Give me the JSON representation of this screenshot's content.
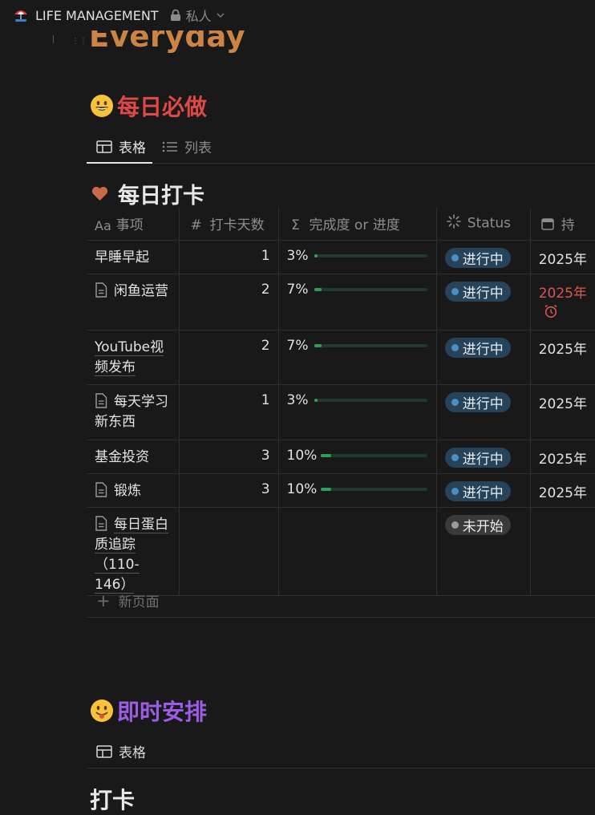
{
  "topbar": {
    "app_title": "LIFE MANAGEMENT",
    "privacy": "私人",
    "app_icon": "beach-umbrella-icon"
  },
  "page": {
    "title": "Everyday"
  },
  "section1": {
    "title": "每日必做",
    "title_color": "#e04848",
    "emoji": "grinning-face",
    "tabs": [
      {
        "label": "表格",
        "icon": "table-icon",
        "active": true
      },
      {
        "label": "列表",
        "icon": "list-icon",
        "active": false
      }
    ],
    "db_title": "每日打卡",
    "columns": [
      {
        "icon": "Aa",
        "label": "事项"
      },
      {
        "icon": "#",
        "label": "打卡天数"
      },
      {
        "icon": "Σ",
        "label": "完成度 or 进度"
      },
      {
        "icon": "status-icon",
        "label": "Status"
      },
      {
        "icon": "calendar-icon",
        "label": "持"
      }
    ],
    "rows": [
      {
        "name": "早睡早起",
        "page": false,
        "days": "1",
        "pct": "3%",
        "progress": 0.03,
        "status": "进行中",
        "date": "2025年"
      },
      {
        "name": "闲鱼运营",
        "page": true,
        "days": "2",
        "pct": "7%",
        "progress": 0.07,
        "status": "进行中",
        "date": "2025年"
      },
      {
        "name": "YouTube视频发布",
        "page": false,
        "days": "2",
        "pct": "7%",
        "progress": 0.07,
        "status": "进行中",
        "date": "2025年"
      },
      {
        "name": "每天学习新东西",
        "page": true,
        "days": "1",
        "pct": "3%",
        "progress": 0.03,
        "status": "进行中",
        "date": "2025年"
      },
      {
        "name": "基金投资",
        "page": false,
        "days": "3",
        "pct": "10%",
        "progress": 0.1,
        "status": "进行中",
        "date": "2025年"
      },
      {
        "name": "锻炼",
        "page": true,
        "days": "3",
        "pct": "10%",
        "progress": 0.1,
        "status": "进行中",
        "date": "2025年"
      },
      {
        "name": "每日蛋白质追踪（110-146）",
        "page": true,
        "days": "",
        "pct": "",
        "progress": null,
        "status": "未开始",
        "date": ""
      }
    ],
    "new_page": "新页面"
  },
  "section2": {
    "title": "即时安排",
    "title_color": "#9b5de5",
    "emoji": "tongue-face",
    "tabs": [
      {
        "label": "表格",
        "icon": "table-icon",
        "active": false
      }
    ],
    "db_title": "打卡"
  },
  "colors": {
    "background": "#191919",
    "progress_fill": "#2f9e5b",
    "status_in_progress": "#27435a",
    "status_todo": "#3a3a3a",
    "overdue": "#d8574f"
  }
}
